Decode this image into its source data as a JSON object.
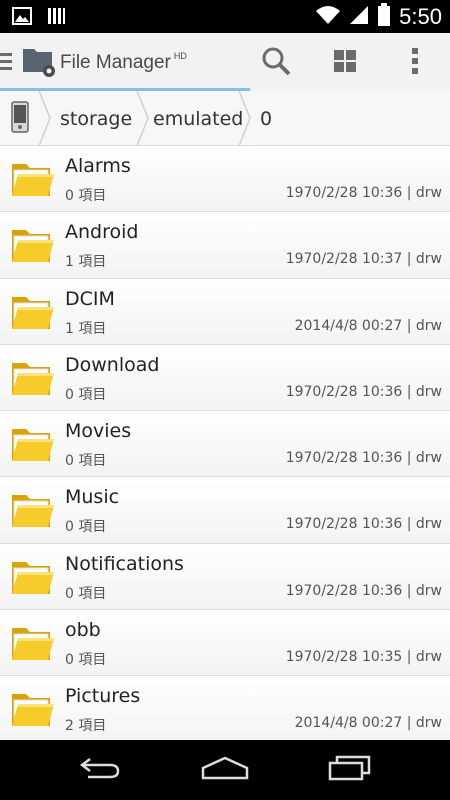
{
  "status_bar": {
    "time": "5:50",
    "icons": [
      "image-icon",
      "sim-bars-icon",
      "wifi-icon",
      "signal-icon",
      "battery-icon"
    ]
  },
  "action_bar": {
    "title": "File Manager",
    "title_suffix": "HD",
    "actions": [
      "search-icon",
      "grid-view-icon",
      "overflow-menu-icon"
    ]
  },
  "breadcrumb": {
    "items": [
      "storage",
      "emulated",
      "0"
    ]
  },
  "files": [
    {
      "name": "Alarms",
      "count": "0 項目",
      "meta": "1970/2/28 10:36 | drw"
    },
    {
      "name": "Android",
      "count": "1 項目",
      "meta": "1970/2/28 10:37 | drw"
    },
    {
      "name": "DCIM",
      "count": "1 項目",
      "meta": "2014/4/8 00:27 | drw"
    },
    {
      "name": "Download",
      "count": "0 項目",
      "meta": "1970/2/28 10:36 | drw"
    },
    {
      "name": "Movies",
      "count": "0 項目",
      "meta": "1970/2/28 10:36 | drw"
    },
    {
      "name": "Music",
      "count": "0 項目",
      "meta": "1970/2/28 10:36 | drw"
    },
    {
      "name": "Notifications",
      "count": "0 項目",
      "meta": "1970/2/28 10:36 | drw"
    },
    {
      "name": "obb",
      "count": "0 項目",
      "meta": "1970/2/28 10:35 | drw"
    },
    {
      "name": "Pictures",
      "count": "2 項目",
      "meta": "2014/4/8 00:27 | drw"
    }
  ],
  "nav_bar": {
    "buttons": [
      "back-icon",
      "home-icon",
      "recents-icon"
    ]
  },
  "colors": {
    "accent": "#7ec3ea",
    "folder": "#f5c518",
    "action_bar": "#f2f2f2"
  }
}
